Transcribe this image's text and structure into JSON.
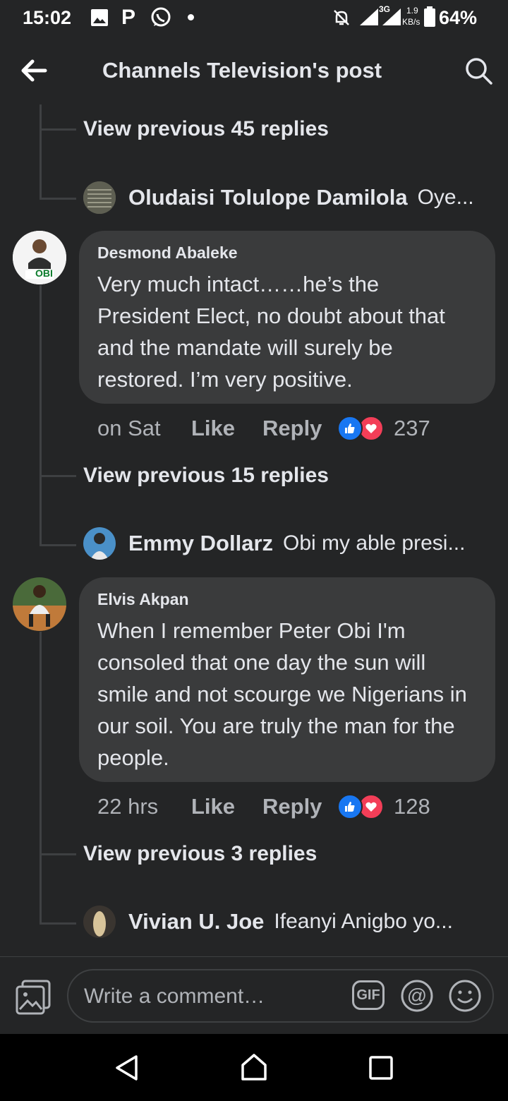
{
  "status_bar": {
    "time": "15:02",
    "battery": "64%",
    "network": "3G",
    "speed_value": "1.9",
    "speed_unit": "KB/s",
    "icons": [
      "gallery-icon",
      "p-app-icon",
      "whatsapp-icon",
      "dot-icon",
      "mute-bell-icon",
      "signal-icon",
      "signal-3g-icon",
      "battery-icon"
    ]
  },
  "header": {
    "title": "Channels Television's post",
    "back_icon": "arrow-left-icon",
    "search_icon": "search-icon"
  },
  "thread": [
    {
      "view_previous": "View previous 45 replies",
      "last_reply": {
        "name": "Oludaisi Tolulope Damilola",
        "text": "Oye..."
      }
    },
    {
      "comment": {
        "author": "Desmond Abaleke",
        "avatar_badge": "OBI",
        "text": "Very much intact……he’s the President Elect, no doubt about that and the mandate will surely be restored. I’m very positive.",
        "time": "on Sat",
        "like": "Like",
        "reply": "Reply",
        "reaction_count": "237"
      },
      "view_previous": "View previous 15 replies",
      "last_reply": {
        "name": "Emmy Dollarz",
        "text": "Obi my able presi..."
      }
    },
    {
      "comment": {
        "author": "Elvis Akpan",
        "text": "When I remember Peter Obi I'm consoled that one day the sun will smile and not scourge we Nigerians in our soil.  You are truly the man for the people.",
        "time": "22 hrs",
        "like": "Like",
        "reply": "Reply",
        "reaction_count": "128"
      },
      "view_previous": "View previous 3 replies",
      "last_reply": {
        "name": "Vivian U. Joe",
        "text": "Ifeanyi Anigbo yo..."
      }
    }
  ],
  "composer": {
    "placeholder": "Write a comment…",
    "photo_icon": "photo-icon",
    "gif_label": "GIF",
    "gif_icon": "gif-icon",
    "mention_icon": "at-icon",
    "emoji_icon": "emoji-icon"
  },
  "navbar": {
    "back": "nav-back-icon",
    "home": "nav-home-icon",
    "recents": "nav-recents-icon"
  },
  "colors": {
    "background": "#242526",
    "bubble": "#3a3b3c",
    "text": "#e4e6eb",
    "muted": "#b0b3b8",
    "like": "#1877f2",
    "love": "#f33e58"
  }
}
